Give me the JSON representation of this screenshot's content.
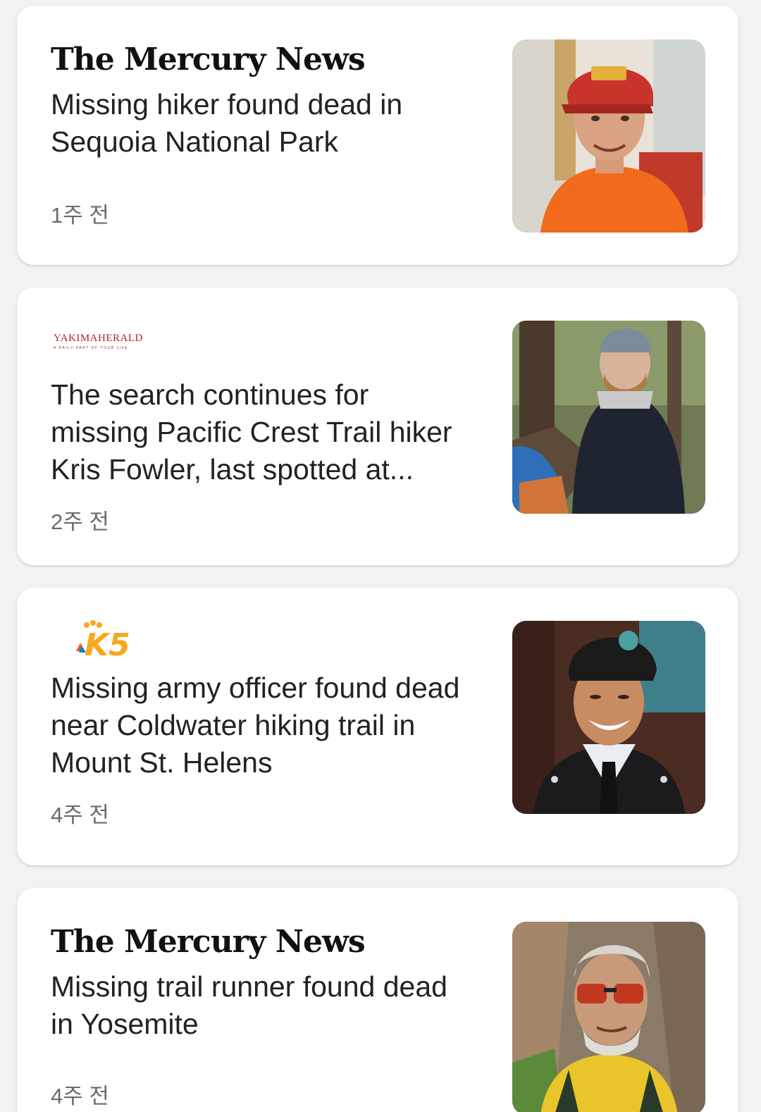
{
  "articles": [
    {
      "source": "The Mercury News",
      "headline": "Missing hiker found dead in Sequoia National Park",
      "time": "1주 전",
      "thumbnail_icon": "man-orange-shirt-red-cap-photo"
    },
    {
      "source": "YAKIMAHERALD",
      "source_tagline": "A DAILY PART OF YOUR LIFE",
      "headline": "The search continues for missing Pacific Crest Trail hiker Kris Fowler, last spotted at...",
      "time": "2주 전",
      "thumbnail_icon": "man-beanie-forest-photo"
    },
    {
      "source": "K5",
      "headline": "Missing army officer found dead near Coldwater hiking trail in Mount St. Helens",
      "time": "4주 전",
      "thumbnail_icon": "soldier-uniform-beret-photo"
    },
    {
      "source": "The Mercury News",
      "headline": "Missing trail runner found dead in Yosemite",
      "time": "4주 전",
      "thumbnail_icon": "man-sunglasses-yellow-shirt-photo"
    }
  ],
  "colors": {
    "card_bg": "#ffffff",
    "page_bg": "#f2f2f2",
    "headline": "#222222",
    "timestamp": "#6b6b6b",
    "yakima_red": "#b81c2c",
    "k5_yellow": "#f7a81b"
  }
}
